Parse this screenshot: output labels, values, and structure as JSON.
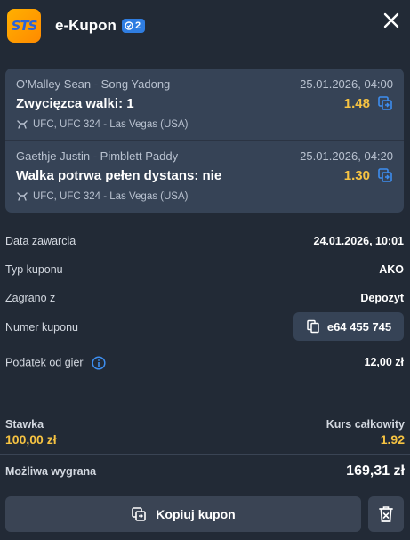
{
  "header": {
    "logo_text": "STS",
    "title": "e-Kupon",
    "bet_count": "2"
  },
  "events": [
    {
      "teams": "O'Malley Sean - Song Yadong",
      "date": "25.01.2026, 04:00",
      "selection": "Zwycięzca walki: 1",
      "odds": "1.48",
      "league": "UFC, UFC 324 - Las Vegas (USA)"
    },
    {
      "teams": "Gaethje Justin - Pimblett Paddy",
      "date": "25.01.2026, 04:20",
      "selection": "Walka potrwa pełen dystans: nie",
      "odds": "1.30",
      "league": "UFC, UFC 324 - Las Vegas (USA)"
    }
  ],
  "details": {
    "date_label": "Data zawarcia",
    "date_value": "24.01.2026, 10:01",
    "type_label": "Typ kuponu",
    "type_value": "AKO",
    "source_label": "Zagrano z",
    "source_value": "Depozyt",
    "coupon_label": "Numer kuponu",
    "coupon_value": "e64 455 745",
    "tax_label": "Podatek od gier",
    "tax_value": "12,00 zł"
  },
  "summary": {
    "stake_label": "Stawka",
    "stake_value": "100,00 zł",
    "total_odds_label": "Kurs całkowity",
    "total_odds_value": "1.92",
    "win_label": "Możliwa wygrana",
    "win_value": "169,31 zł"
  },
  "actions": {
    "copy_label": "Kopiuj kupon"
  },
  "colors": {
    "background": "#222a36",
    "card": "#364356",
    "accent_yellow": "#f6c342",
    "badge_blue": "#2f7de1"
  }
}
